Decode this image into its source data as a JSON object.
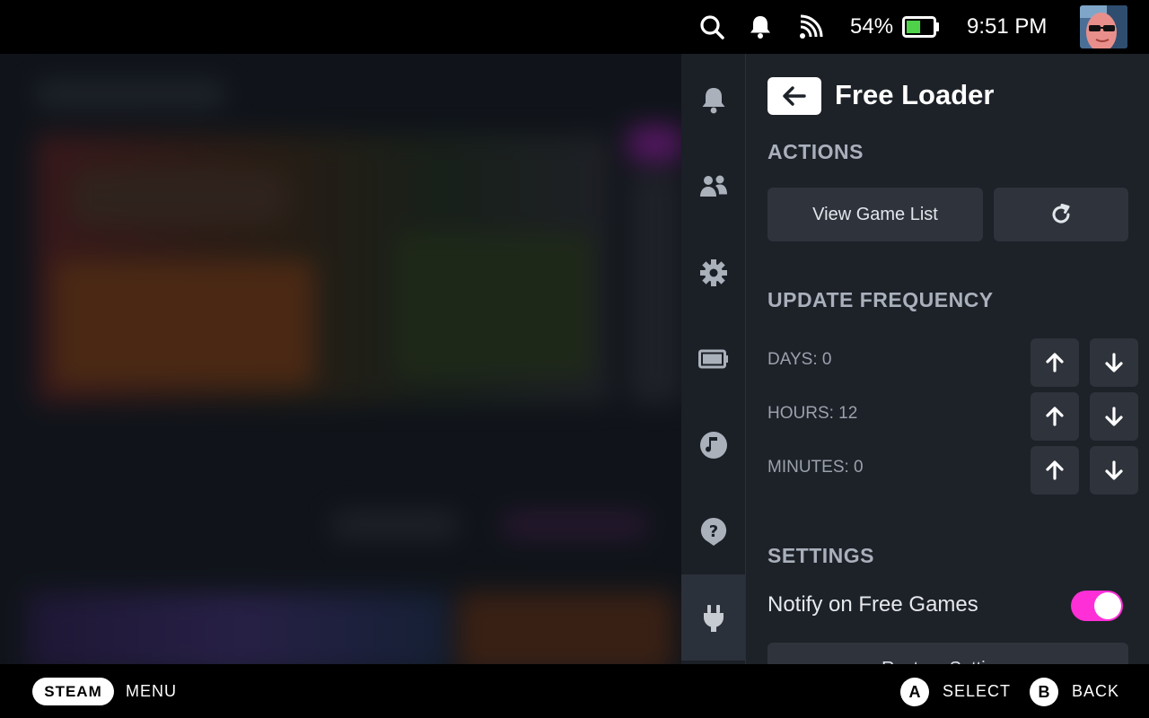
{
  "status_bar": {
    "battery_percent": "54%",
    "battery_level": 0.54,
    "time": "9:51 PM",
    "icons": [
      "search-icon",
      "bell-icon",
      "wifi-icon",
      "battery-icon"
    ]
  },
  "quick_access_nav": {
    "items": [
      {
        "icon": "bell-icon",
        "name": "notifications"
      },
      {
        "icon": "friends-icon",
        "name": "friends"
      },
      {
        "icon": "gear-icon",
        "name": "settings"
      },
      {
        "icon": "battery-icon",
        "name": "performance"
      },
      {
        "icon": "music-icon",
        "name": "music"
      },
      {
        "icon": "help-icon",
        "name": "help"
      },
      {
        "icon": "plug-icon",
        "name": "plugins",
        "active": true
      }
    ]
  },
  "panel": {
    "title": "Free Loader",
    "actions_title": "ACTIONS",
    "view_game_list_label": "View Game List",
    "update_frequency_title": "UPDATE FREQUENCY",
    "frequency": {
      "days": "DAYS: 0",
      "hours": "HOURS: 12",
      "minutes": "MINUTES: 0"
    },
    "settings_title": "SETTINGS",
    "notify_label": "Notify on Free Games",
    "notify_enabled": true,
    "restore_label": "Restore Settings"
  },
  "bottom_bar": {
    "steam_label": "STEAM",
    "menu_label": "MENU",
    "a_button": "A",
    "select_label": "SELECT",
    "b_button": "B",
    "back_label": "BACK"
  },
  "colors": {
    "accent_toggle": "#ff2fd7",
    "battery_fill": "#4fd14a"
  }
}
